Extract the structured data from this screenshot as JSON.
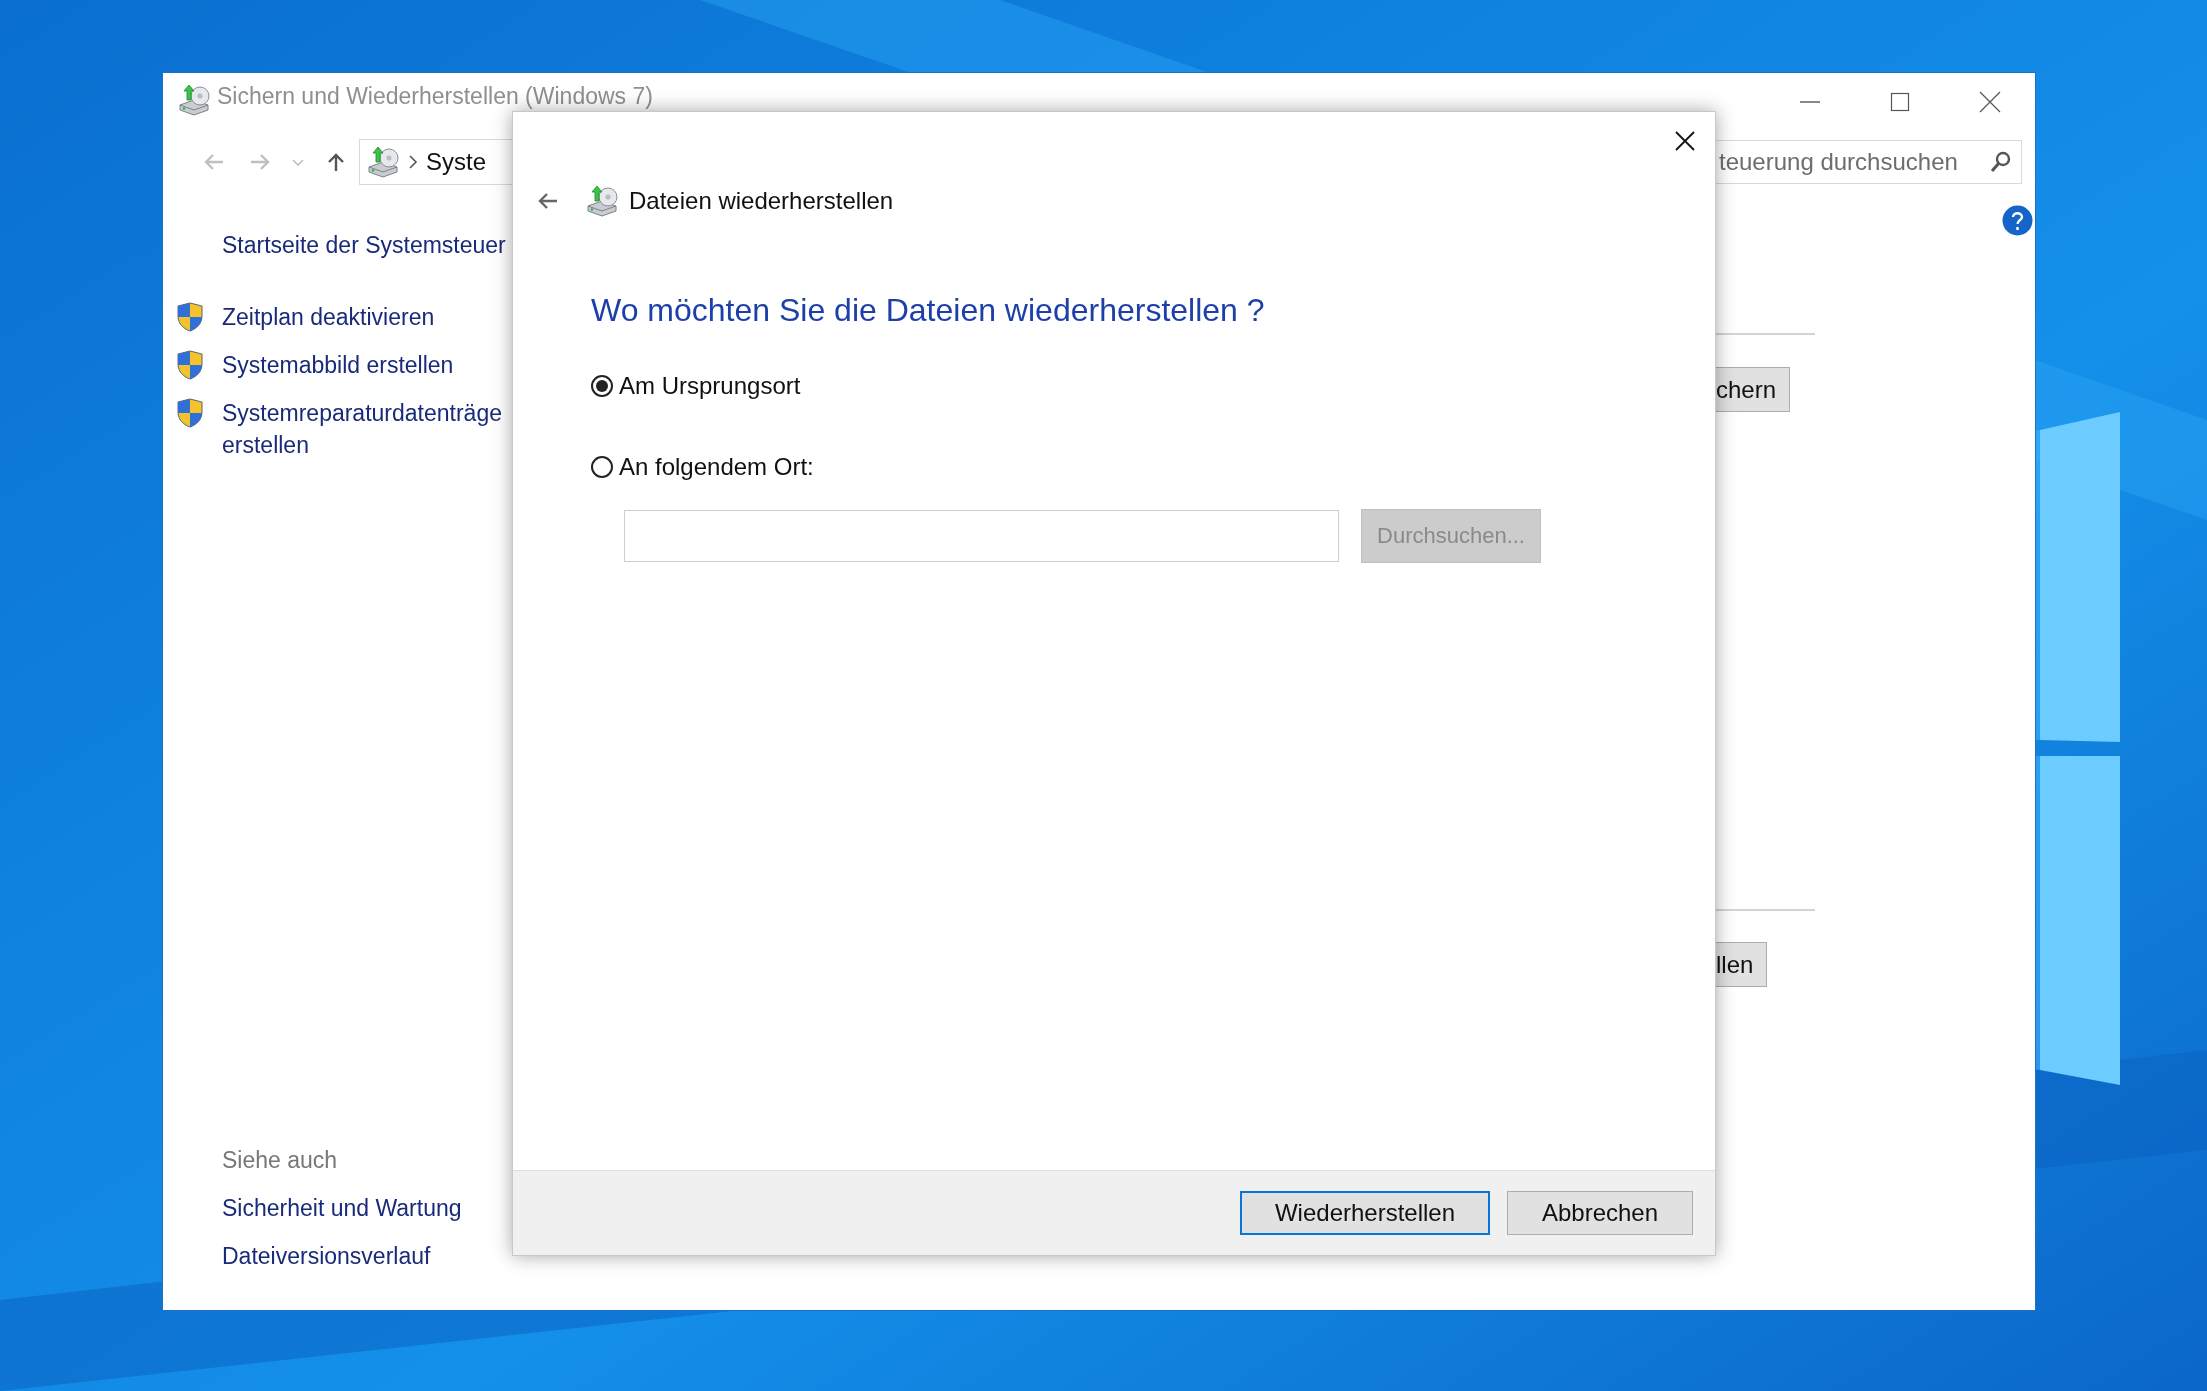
{
  "main_window": {
    "title": "Sichern und Wiederherstellen (Windows 7)",
    "address_bar": {
      "crumb": "Syste"
    },
    "search": {
      "placeholder": "teuerung durchsuchen"
    },
    "sidebar": {
      "home_link": "Startseite der Systemsteuer",
      "tasks": [
        {
          "label": "Zeitplan deaktivieren"
        },
        {
          "label": "Systemabbild erstellen"
        },
        {
          "label": "Systemreparaturdatenträge erstellen"
        }
      ],
      "see_also": {
        "heading": "Siehe auch",
        "links": [
          "Sicherheit und Wartung",
          "Dateiversionsverlauf"
        ]
      }
    },
    "content_buttons": [
      "chern",
      "llen"
    ]
  },
  "dialog": {
    "title": "Dateien wiederherstellen",
    "heading": "Wo möchten Sie die Dateien wiederherstellen ?",
    "options": [
      {
        "label": "Am Ursprungsort",
        "selected": true
      },
      {
        "label": "An folgendem Ort:",
        "selected": false
      }
    ],
    "browse_button": {
      "label": "Durchsuchen...",
      "disabled": true
    },
    "buttons": [
      {
        "label": "Wiederherstellen",
        "default": true
      },
      {
        "label": "Abbrechen",
        "default": false
      }
    ]
  }
}
